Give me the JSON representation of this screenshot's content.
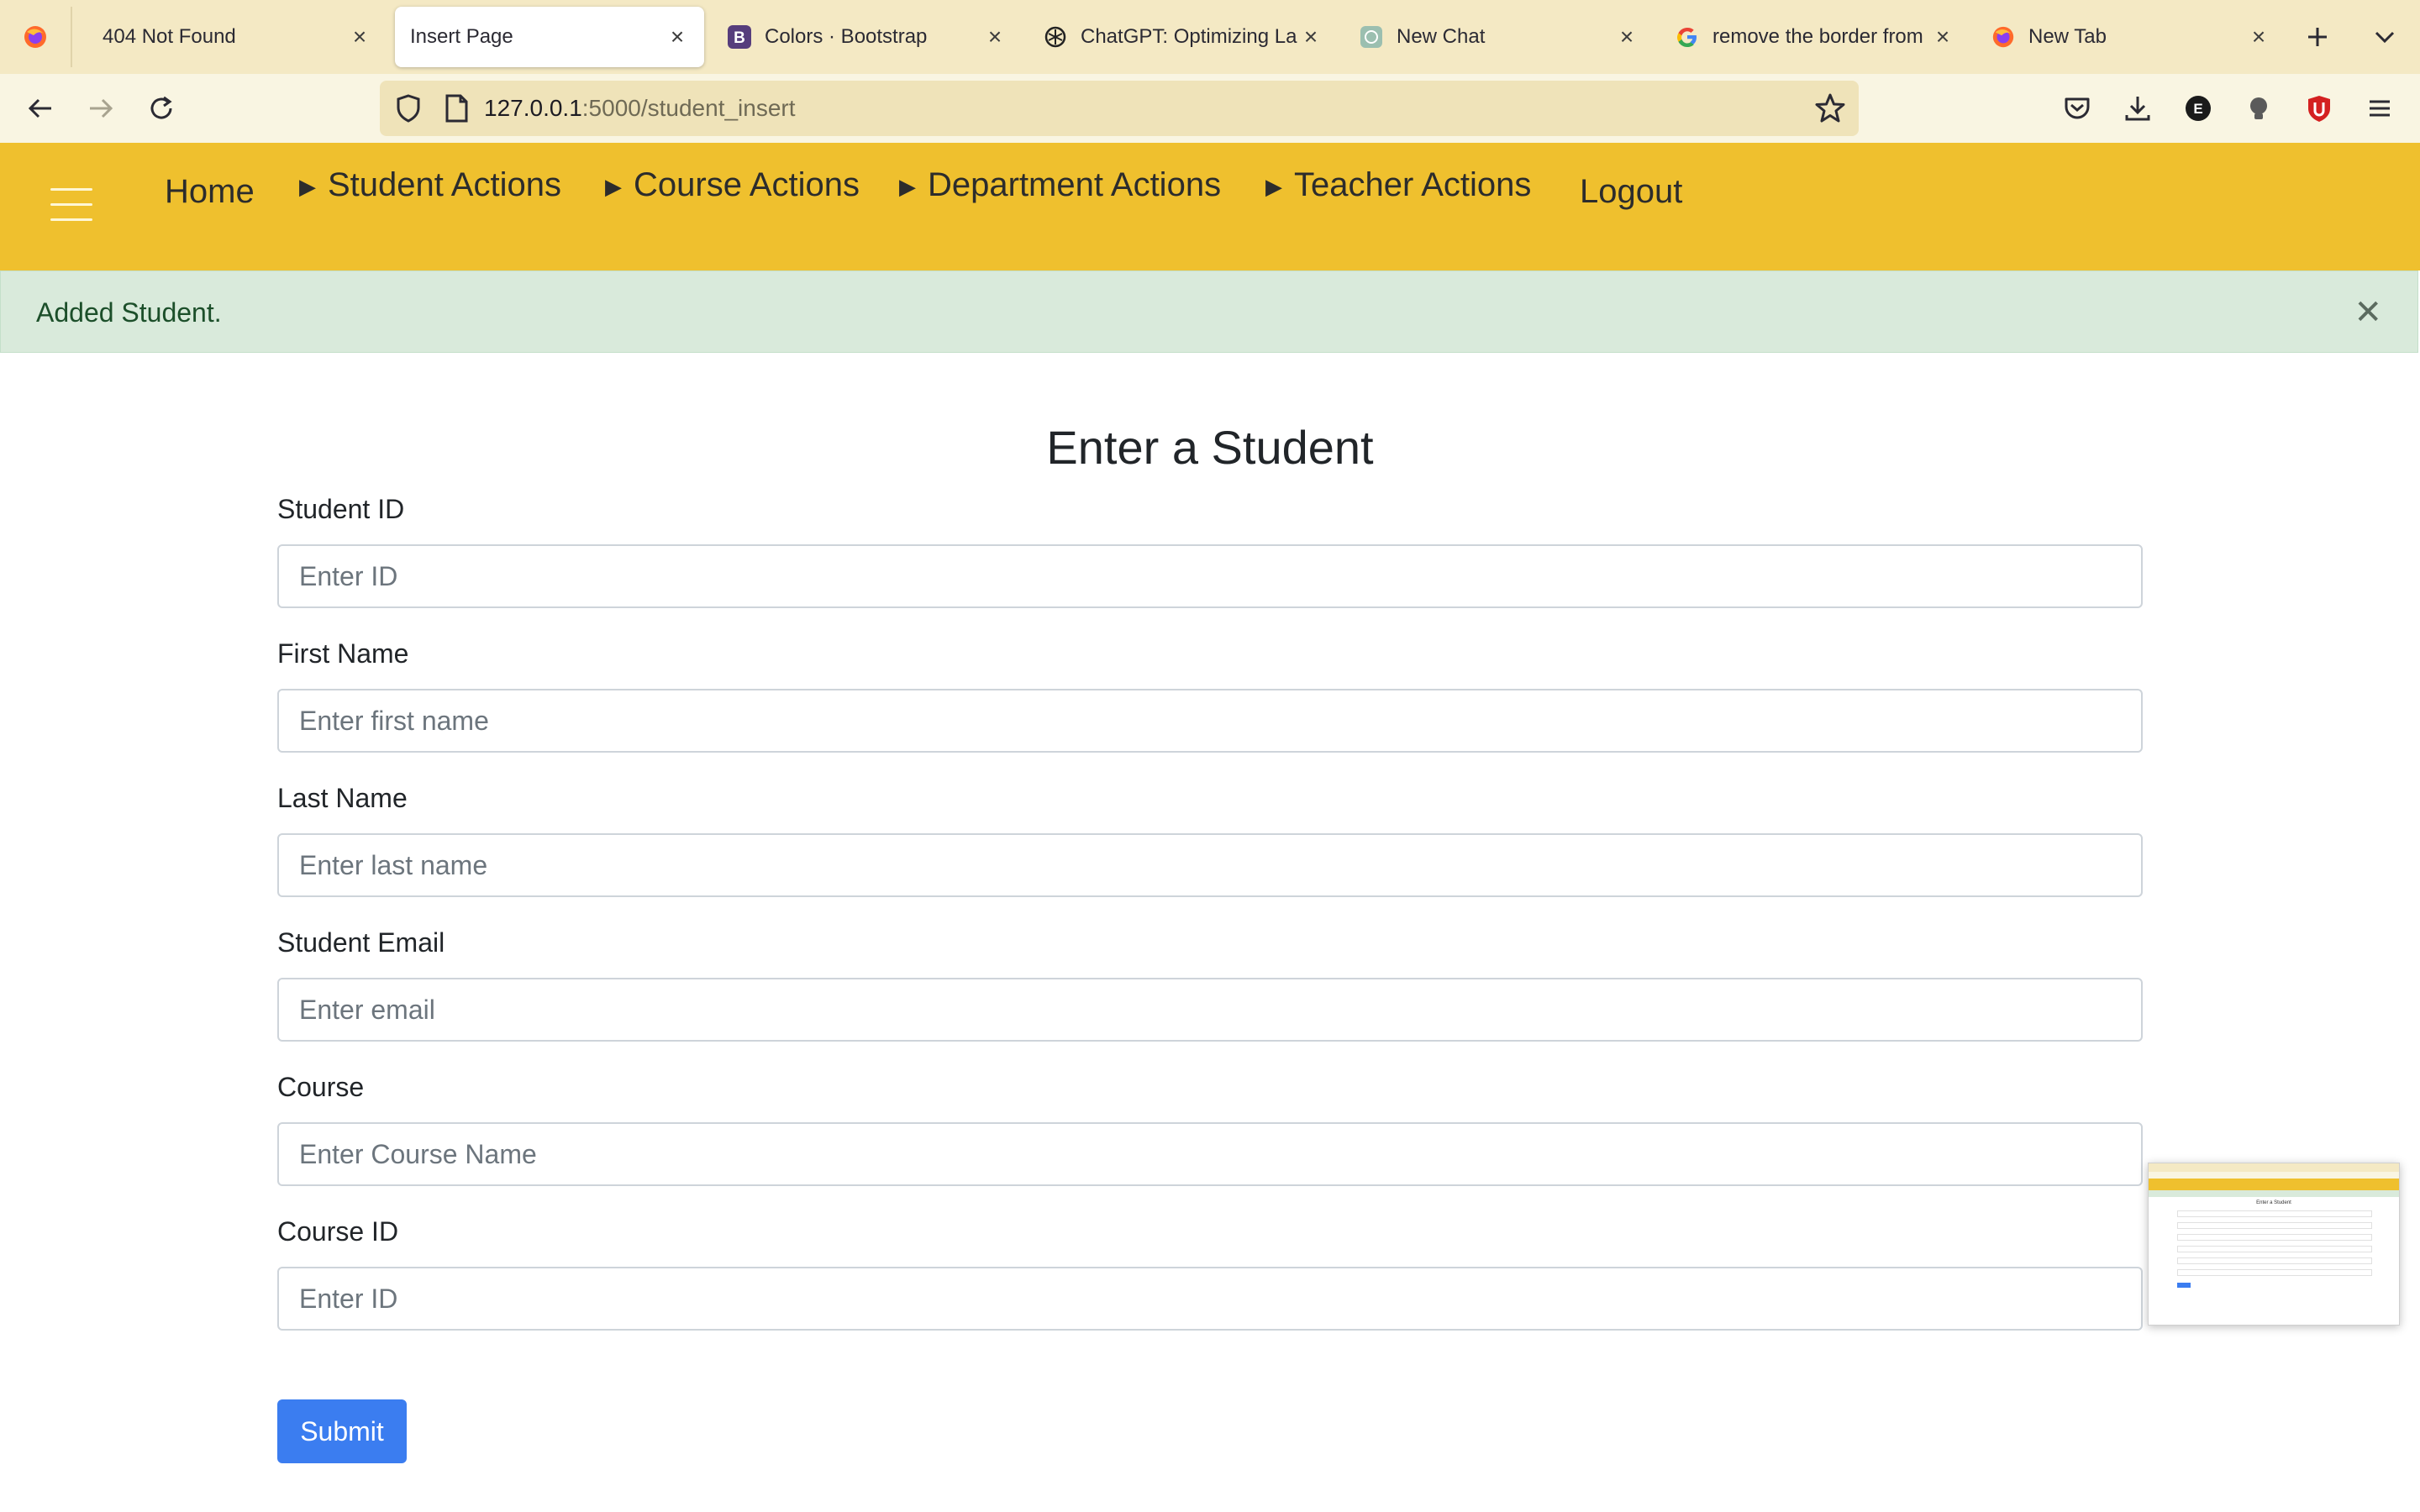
{
  "browser": {
    "tabs": [
      {
        "title": "404 Not Found",
        "icon": "firefox-icon"
      },
      {
        "title": "Insert Page",
        "icon": "none",
        "active": true
      },
      {
        "title": "Colors · Bootstrap",
        "icon": "bootstrap-icon"
      },
      {
        "title": "ChatGPT: Optimizing Lan",
        "icon": "chatgpt-icon"
      },
      {
        "title": "New Chat",
        "icon": "chat-icon"
      },
      {
        "title": "remove the border from",
        "icon": "google-icon"
      },
      {
        "title": "New Tab",
        "icon": "firefox-icon"
      }
    ],
    "url_host": "127.0.0.1",
    "url_path": ":5000/student_insert",
    "profile_initial": "E"
  },
  "header": {
    "menu": [
      {
        "label": "Home",
        "arrow": false
      },
      {
        "label": "Student Actions",
        "arrow": true
      },
      {
        "label": "Course Actions",
        "arrow": true
      },
      {
        "label": "Department Actions",
        "arrow": true
      },
      {
        "label": "Teacher Actions",
        "arrow": true
      },
      {
        "label": "Logout",
        "arrow": false
      }
    ],
    "arrow_glyph": "▶"
  },
  "alert": {
    "message": "Added Student.",
    "close": "✕"
  },
  "form": {
    "title": "Enter a Student",
    "fields": [
      {
        "label": "Student ID",
        "placeholder": "Enter ID"
      },
      {
        "label": "First Name",
        "placeholder": "Enter first name"
      },
      {
        "label": "Last Name",
        "placeholder": "Enter last name"
      },
      {
        "label": "Student Email",
        "placeholder": "Enter email"
      },
      {
        "label": "Course",
        "placeholder": "Enter Course Name"
      },
      {
        "label": "Course ID",
        "placeholder": "Enter ID"
      }
    ],
    "submit_label": "Submit"
  },
  "thumbnail": {
    "title": "Enter a Student"
  },
  "colors": {
    "header_bg": "#efc02e",
    "alert_bg": "#d9eadb",
    "submit_bg": "#3b7df0",
    "tabstrip_bg": "#f4e9c4"
  }
}
